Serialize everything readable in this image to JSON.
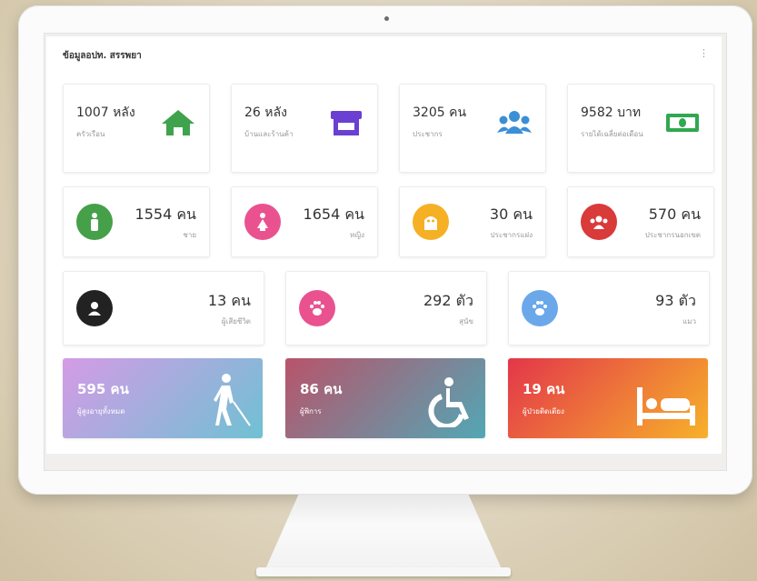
{
  "panel": {
    "title": "ข้อมูลอปท. สรรพยา",
    "menu": "⋮"
  },
  "row1": [
    {
      "value": "1007 หลัง",
      "label": "ครัวเรือน",
      "icon": "home-icon",
      "color": "#3fa34d"
    },
    {
      "value": "26 หลัง",
      "label": "บ้านและร้านค้า",
      "icon": "store-icon",
      "color": "#6a3fd1"
    },
    {
      "value": "3205 คน",
      "label": "ประชากร",
      "icon": "users-icon",
      "color": "#3b8fd6"
    },
    {
      "value": "9582 บาท",
      "label": "รายได้เฉลี่ยต่อเดือน",
      "icon": "money-icon",
      "color": "#2fa84f"
    }
  ],
  "row2": [
    {
      "value": "1554 คน",
      "label": "ชาย",
      "icon": "male-icon",
      "color": "#45a049"
    },
    {
      "value": "1654 คน",
      "label": "หญิง",
      "icon": "female-icon",
      "color": "#e9528f"
    },
    {
      "value": "30 คน",
      "label": "ประชากรแฝง",
      "icon": "ghost-icon",
      "color": "#f5b025"
    },
    {
      "value": "570 คน",
      "label": "ประชากรนอกเขต",
      "icon": "group-icon",
      "color": "#d93a3a"
    }
  ],
  "row3": [
    {
      "value": "13 คน",
      "label": "ผู้เสียชีวิต",
      "icon": "user-icon",
      "color": "#222222"
    },
    {
      "value": "292 ตัว",
      "label": "สุนัข",
      "icon": "paw-icon",
      "color": "#e9528f"
    },
    {
      "value": "93 ตัว",
      "label": "แมว",
      "icon": "paw-icon",
      "color": "#6aa8ea"
    }
  ],
  "row4": [
    {
      "value": "595 คน",
      "label": "ผู้สูงอายุทั้งหมด",
      "icon": "blind-person-icon",
      "gradient": [
        "#d59be6",
        "#6fc1d3"
      ]
    },
    {
      "value": "86 คน",
      "label": "ผู้พิการ",
      "icon": "wheelchair-icon",
      "gradient": [
        "#b9536a",
        "#52a7b5"
      ]
    },
    {
      "value": "19 คน",
      "label": "ผู้ป่วยติดเตียง",
      "icon": "bed-icon",
      "gradient": [
        "#e3364a",
        "#f7b12a"
      ]
    }
  ]
}
